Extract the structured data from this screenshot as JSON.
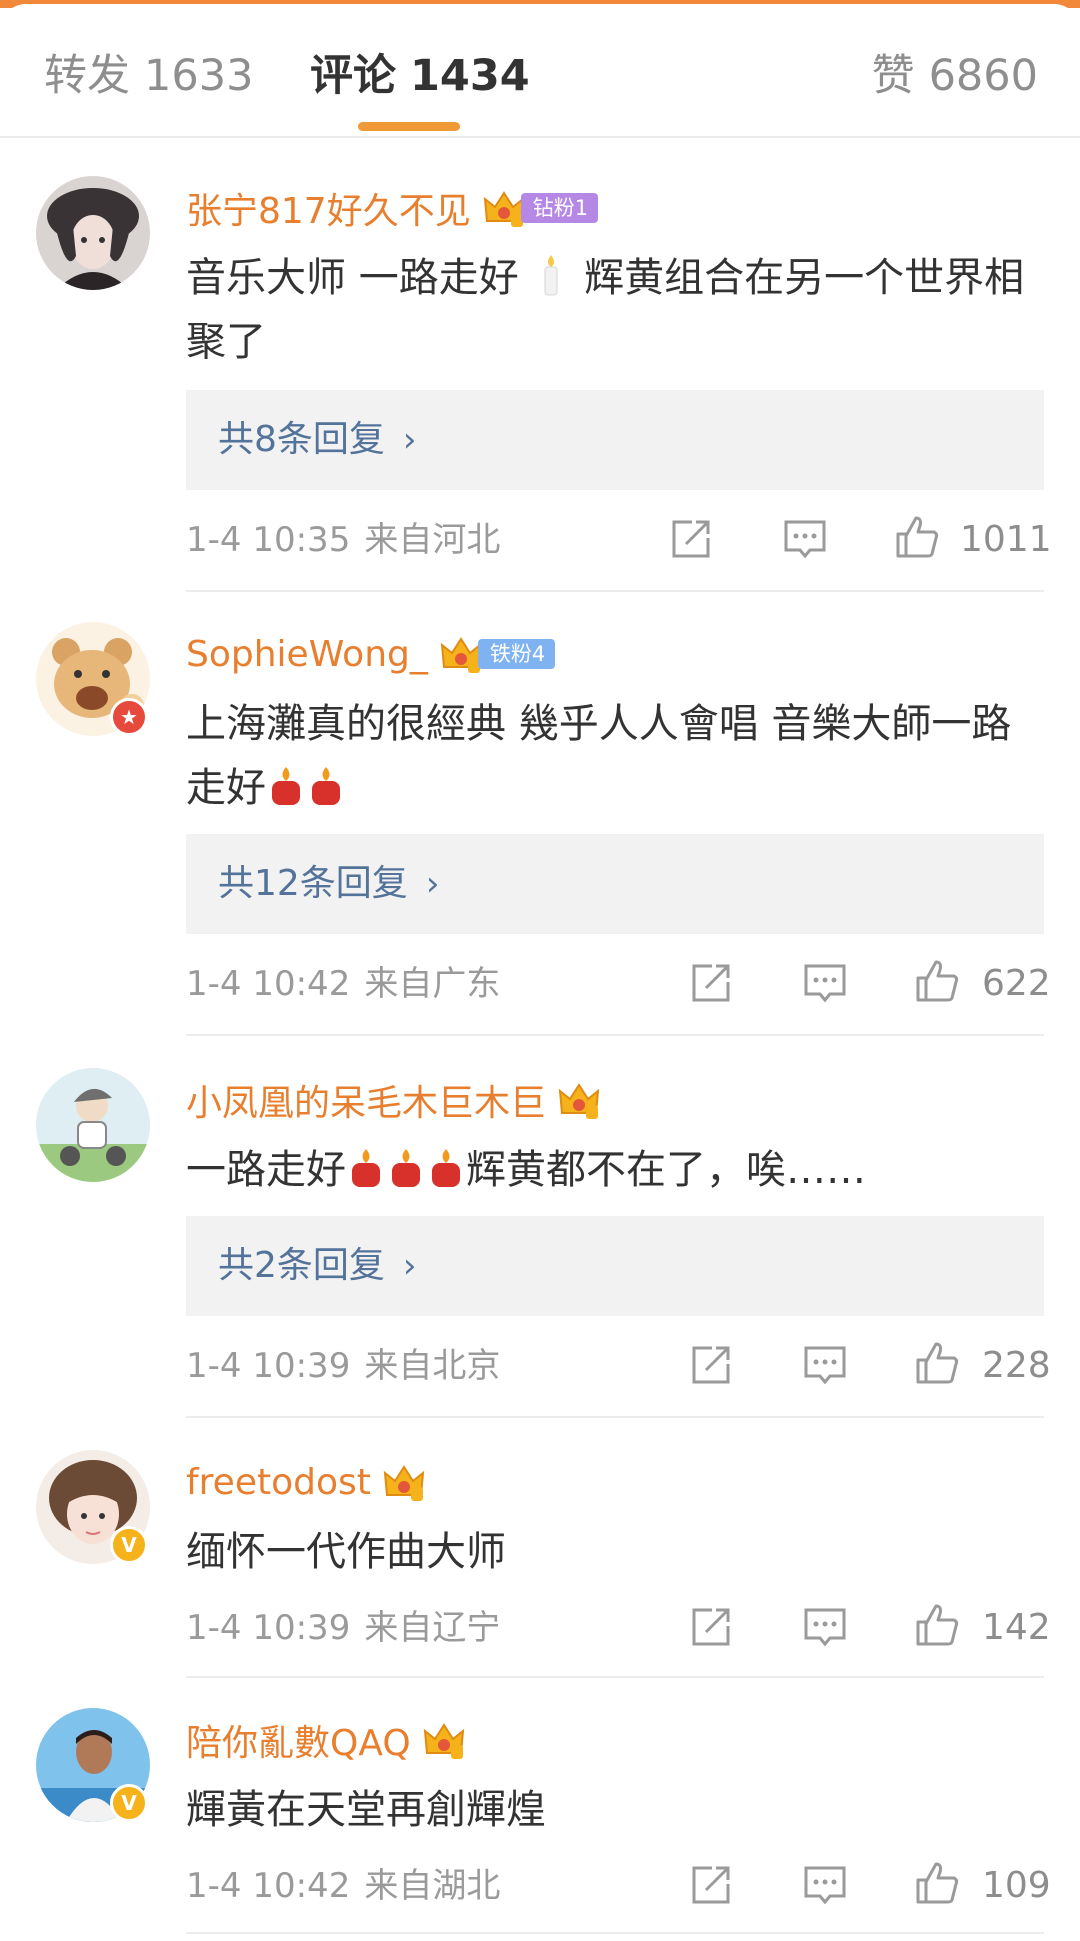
{
  "tabs": {
    "repost": {
      "label": "转发",
      "count": "1633"
    },
    "comment": {
      "label": "评论",
      "count": "1434"
    },
    "like": {
      "label": "赞",
      "count": "6860"
    }
  },
  "colors": {
    "accent": "#f09a37",
    "username": "#e77f2f",
    "reply_link": "#53739a",
    "meta": "#9a9a9a"
  },
  "icons": [
    "share-icon",
    "comment-icon",
    "like-icon",
    "chevron-right-icon",
    "crown-icon",
    "candle-emoji",
    "verified-badge"
  ],
  "comments": [
    {
      "username": "张宁817好久不见",
      "fan_badge": "钻粉1",
      "text_parts": [
        "音乐大师 一路走好",
        "辉黄组合在另一个世界相聚了"
      ],
      "emoji": "candle",
      "reply": "共8条回复",
      "time": "1-4 10:35",
      "location": "来自河北",
      "likes": "1011"
    },
    {
      "username": "SophieWong_",
      "fan_badge": "铁粉4",
      "text_parts": [
        "上海灘真的很經典 幾乎人人會唱 音樂大師一路走好"
      ],
      "emoji": "candle x2",
      "reply": "共12条回复",
      "time": "1-4 10:42",
      "location": "来自广东",
      "likes": "622"
    },
    {
      "username": "小凤凰的呆毛木巨木巨",
      "text_parts": [
        "一路走好",
        "辉黄都不在了，唉……"
      ],
      "emoji": "candle x3",
      "reply": "共2条回复",
      "time": "1-4 10:39",
      "location": "来自北京",
      "likes": "228"
    },
    {
      "username": "freetodost",
      "text_parts": [
        "缅怀一代作曲大师"
      ],
      "time": "1-4 10:39",
      "location": "来自辽宁",
      "likes": "142"
    },
    {
      "username": "陪你亂數QAQ",
      "text_parts": [
        "輝黃在天堂再創輝煌"
      ],
      "time": "1-4 10:42",
      "location": "来自湖北",
      "likes": "109"
    }
  ]
}
